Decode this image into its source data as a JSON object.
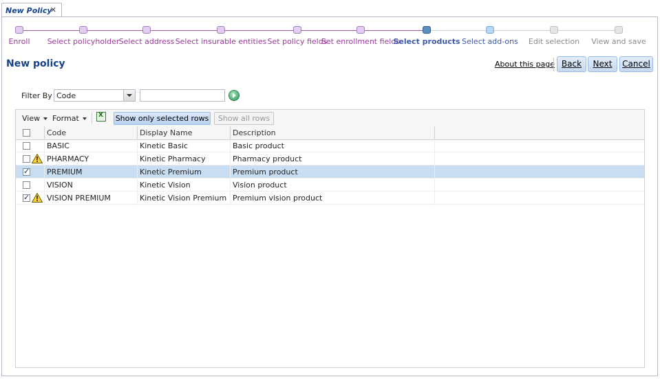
{
  "tab": {
    "title": "New Policy",
    "close": "✕"
  },
  "steps": [
    {
      "label": "Enroll",
      "state": "done"
    },
    {
      "label": "Select policyholder",
      "state": "done"
    },
    {
      "label": "Select address",
      "state": "done"
    },
    {
      "label": "Select insurable entities",
      "state": "done"
    },
    {
      "label": "Set policy fields",
      "state": "done"
    },
    {
      "label": "Set enrollment fields",
      "state": "done"
    },
    {
      "label": "Select products",
      "state": "current"
    },
    {
      "label": "Select add-ons",
      "state": "next"
    },
    {
      "label": "Edit selection",
      "state": "disabled"
    },
    {
      "label": "View and save",
      "state": "disabled"
    }
  ],
  "page": {
    "title": "New policy",
    "about": "About this page"
  },
  "buttons": {
    "back": "Back",
    "next": "Next",
    "cancel": "Cancel"
  },
  "filter": {
    "label": "Filter By",
    "field": "Code",
    "text": ""
  },
  "toolbar": {
    "view": "View",
    "format": "Format",
    "export_icon": "excel-export-icon",
    "show_selected": "Show only selected rows",
    "show_all": "Show all rows"
  },
  "grid": {
    "columns": [
      "Code",
      "Display Name",
      "Description"
    ],
    "rows": [
      {
        "code": "BASIC",
        "display": "Kinetic Basic",
        "desc": "Basic product",
        "checked": false,
        "warning": false
      },
      {
        "code": "PHARMACY",
        "display": "Kinetic Pharmacy",
        "desc": "Pharmacy product",
        "checked": false,
        "warning": true
      },
      {
        "code": "PREMIUM",
        "display": "Kinetic Premium",
        "desc": "Premium product",
        "checked": true,
        "warning": false
      },
      {
        "code": "VISION",
        "display": "Kinetic Vision",
        "desc": "Vision product",
        "checked": false,
        "warning": false
      },
      {
        "code": "VISION PREMIUM",
        "display": "Kinetic Vision Premium",
        "desc": "Premium vision product",
        "checked": true,
        "warning": true
      }
    ]
  },
  "colors": {
    "done": "#9b3b9b",
    "current": "#3d5aa8",
    "next": "#3d5aa8",
    "disabled": "#8a8a8a",
    "title": "#15428b"
  }
}
